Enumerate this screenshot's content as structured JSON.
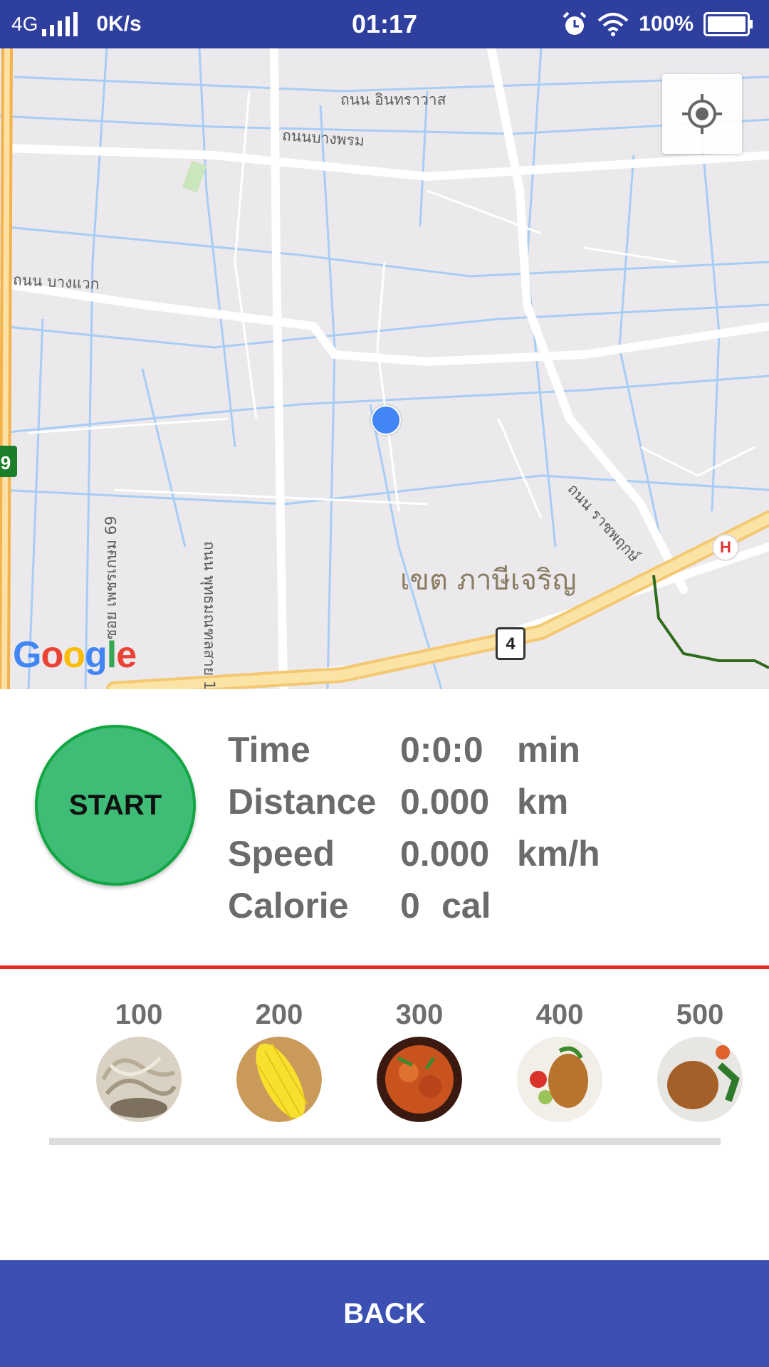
{
  "status_bar": {
    "network": "4G",
    "speed": "0K/s",
    "time": "01:17",
    "battery": "100%",
    "icons": [
      "signal-icon",
      "alarm-icon",
      "wifi-icon",
      "battery-icon"
    ]
  },
  "map": {
    "labels": {
      "road1": "ถนน อินทราวาส",
      "road2": "ถนนบางพรม",
      "road3": "ถนน บางแวก",
      "road4": "ถนน ราชพฤกษ์",
      "road5": "ถนน พุทธมณฑลสาย 1",
      "road6": "ซอย เพชรเกษม 69"
    },
    "district": "เขต ภาษีเจริญ",
    "route_number": "4",
    "highway_number": "9",
    "hospital": "H",
    "attribution": "Google",
    "colors": {
      "background": "#ebe9ec",
      "road": "#ffffff",
      "canal": "#a8cdf5",
      "highway": "#f6d58c",
      "user_dot": "#4285f4"
    }
  },
  "tracker": {
    "start_label": "START",
    "stats": [
      {
        "label": "Time",
        "value": "0:0:0",
        "unit": "min"
      },
      {
        "label": "Distance",
        "value": "0.000",
        "unit": "km"
      },
      {
        "label": "Speed",
        "value": "0.000",
        "unit": "km/h"
      },
      {
        "label": "Calorie",
        "value": "0",
        "unit": "cal"
      }
    ]
  },
  "foods": [
    {
      "calories": "100",
      "icon": "shredded-meat-food-icon"
    },
    {
      "calories": "200",
      "icon": "corn-food-icon"
    },
    {
      "calories": "300",
      "icon": "curry-food-icon"
    },
    {
      "calories": "400",
      "icon": "fried-shrimp-food-icon"
    },
    {
      "calories": "500",
      "icon": "chicken-rice-food-icon"
    }
  ],
  "back_label": "BACK",
  "theme": {
    "status_bar": "#2f3f9e",
    "start_fill": "#3fbc76",
    "start_border": "#11a641",
    "divider": "#e22a22",
    "back_button": "#3c50b4"
  }
}
